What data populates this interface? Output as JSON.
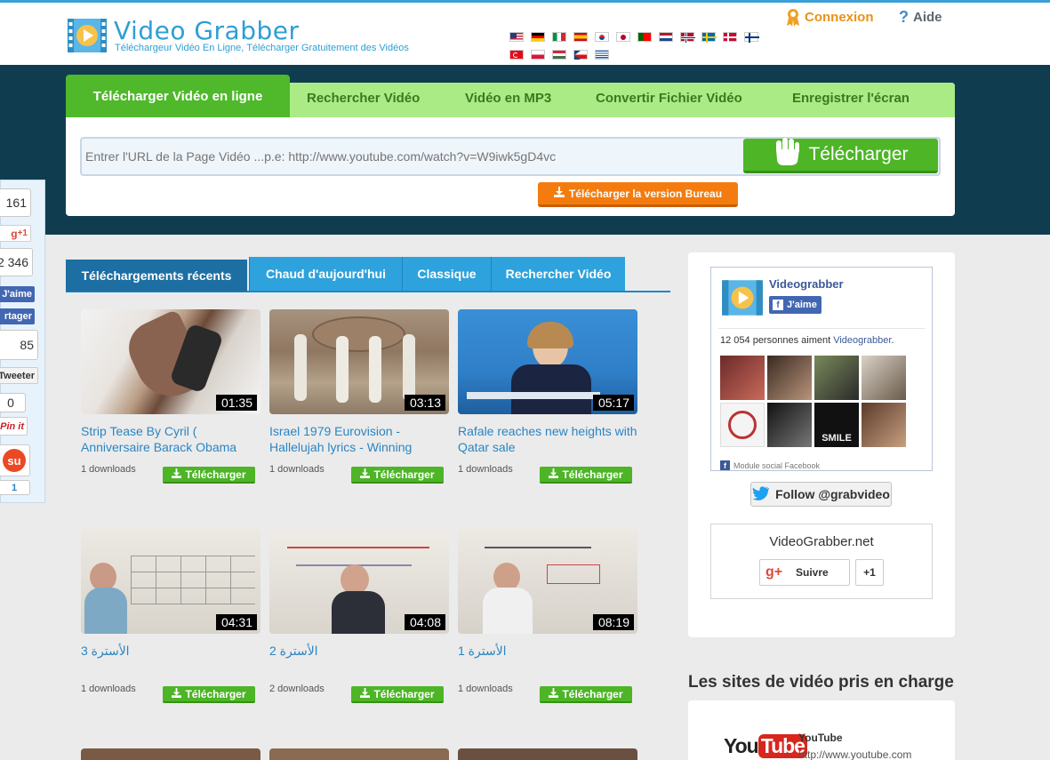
{
  "brand": {
    "title": "Video Grabber",
    "subtitle": "Téléchargeur Vidéo En Ligne, Télécharger Gratuitement des Vidéos"
  },
  "header_links": {
    "connexion": "Connexion",
    "aide": "Aide"
  },
  "main_tabs": {
    "active": "Télécharger Vidéo en ligne",
    "items": [
      "Rechercher Vidéo",
      "Vidéo en MP3",
      "Convertir Fichier Vidéo",
      "Enregistrer l'écran"
    ]
  },
  "search": {
    "placeholder": "Entrer l'URL de la Page Vidéo ...p.e: http://www.youtube.com/watch?v=W9iwk5gD4vc",
    "button": "Télécharger",
    "desktop_button": "Télécharger la version Bureau"
  },
  "social": {
    "fb_count": "161",
    "gplus_label": "+1",
    "gplus_count": "2 346",
    "like_label": "J'aime",
    "share_label": "rtager",
    "tw_count": "85",
    "tweet_label": "Tweeter",
    "pin_count": "0",
    "pin_label": "Pin it",
    "su_count": "1"
  },
  "video_tabs": {
    "active": "Téléchargements récents",
    "items": [
      "Chaud d'aujourd'hui",
      "Classique",
      "Rechercher Vidéo"
    ]
  },
  "videos": [
    {
      "title": "Strip Tease By Cyril ( Anniversaire Barack Obama",
      "duration": "01:35",
      "downloads": "1 downloads",
      "button": "Télécharger"
    },
    {
      "title": "Israel 1979 Eurovision - Hallelujah lyrics - Winning",
      "duration": "03:13",
      "downloads": "1 downloads",
      "button": "Télécharger"
    },
    {
      "title": "Rafale reaches new heights with Qatar sale",
      "duration": "05:17",
      "downloads": "1 downloads",
      "button": "Télécharger"
    },
    {
      "title": "الأسترة 3",
      "duration": "04:31",
      "downloads": "1 downloads",
      "button": "Télécharger"
    },
    {
      "title": "الأسترة 2",
      "duration": "04:08",
      "downloads": "2 downloads",
      "button": "Télécharger"
    },
    {
      "title": "الأسترة 1",
      "duration": "08:19",
      "downloads": "1 downloads",
      "button": "Télécharger"
    }
  ],
  "facebook": {
    "page_name": "Videograbber",
    "like_button": "J'aime",
    "fans_prefix": "12 054 personnes aiment ",
    "fans_link": "Videograbber",
    "fans_suffix": ".",
    "module_label": "Module social Facebook"
  },
  "twitter": {
    "follow": "Follow @grabvideo"
  },
  "gplus_widget": {
    "site": "VideoGrabber.net",
    "follow": "Suivre",
    "plus_one": "+1"
  },
  "sites": {
    "title": "Les sites de vidéo pris en charge",
    "first_name": "YouTube",
    "first_url": "http://www.youtube.com"
  },
  "colors": {
    "accent_blue": "#2e9fd4",
    "green": "#4db526",
    "orange": "#f47c0f",
    "dark_band": "#0f3d4f"
  }
}
